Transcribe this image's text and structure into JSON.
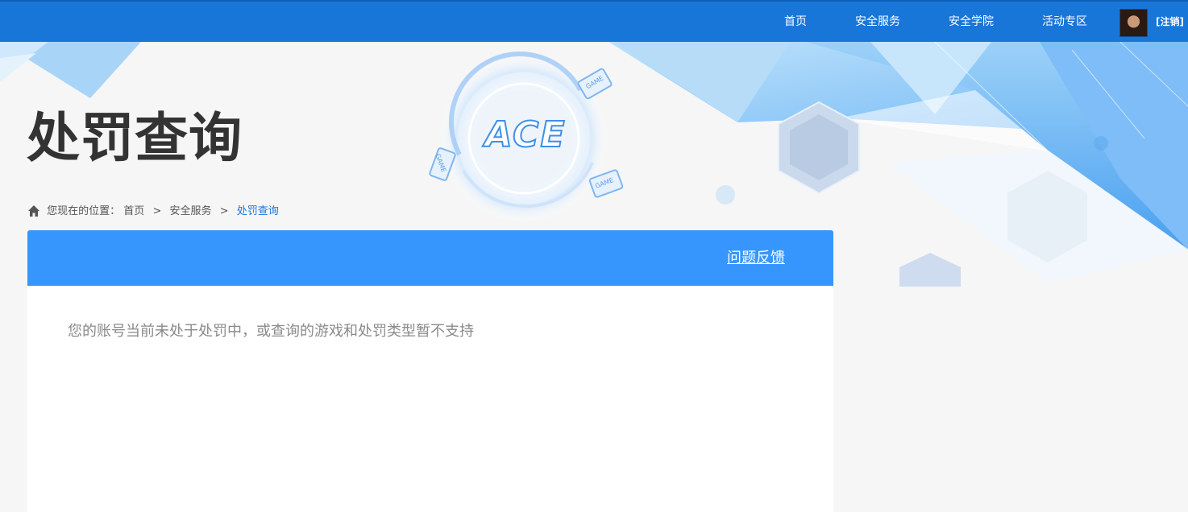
{
  "nav": {
    "items": [
      "首页",
      "安全服务",
      "安全学院",
      "活动专区"
    ],
    "logout_label": "[注销]"
  },
  "hero": {
    "title": "处罚查询",
    "logo_text": "ACE",
    "game_tags": [
      "GAME",
      "GAME",
      "GAME"
    ]
  },
  "breadcrumb": {
    "prefix": "您现在的位置：",
    "items": [
      "首页",
      "安全服务",
      "处罚查询"
    ],
    "separator": ">"
  },
  "panel": {
    "feedback_label": "问题反馈",
    "status_message": "您的账号当前未处于处罚中，或查询的游戏和处罚类型暂不支持"
  },
  "colors": {
    "topbar": "#1976d9",
    "panel_header": "#3796fe",
    "accent": "#1976d9"
  }
}
